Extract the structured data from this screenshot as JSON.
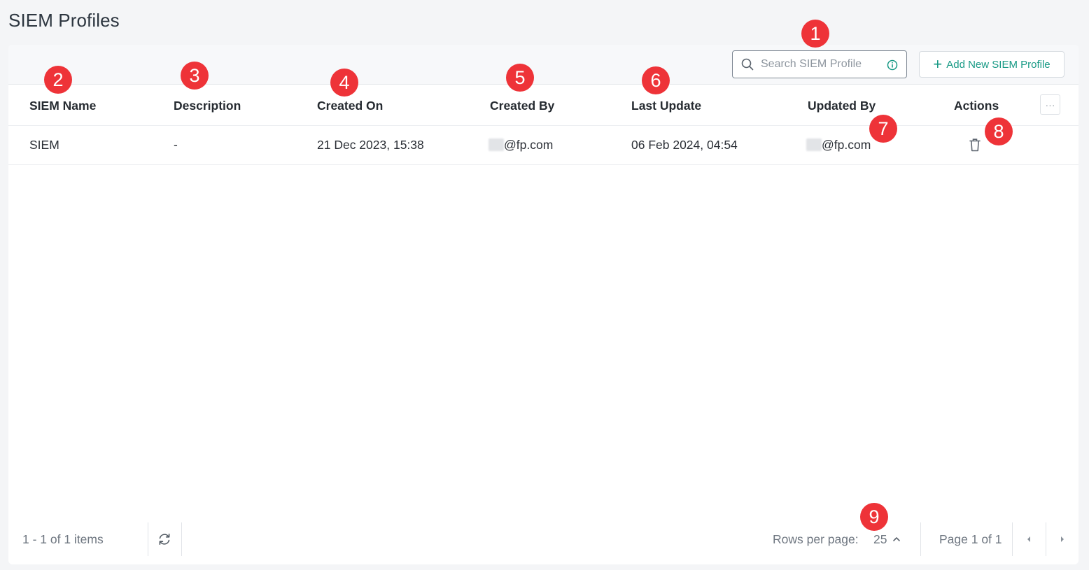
{
  "page": {
    "title": "SIEM Profiles"
  },
  "toolbar": {
    "search_placeholder": "Search SIEM Profile",
    "add_button_label": "Add New SIEM Profile"
  },
  "table": {
    "columns": [
      "SIEM Name",
      "Description",
      "Created On",
      "Created By",
      "Last Update",
      "Updated By",
      "Actions"
    ],
    "rows": [
      {
        "siem_name": "SIEM",
        "description": "-",
        "created_on": "21 Dec 2023, 15:38",
        "created_by": "@fp.com",
        "last_update": "06 Feb 2024, 04:54",
        "updated_by": "@fp.com"
      }
    ],
    "column_menu": "···"
  },
  "footer": {
    "items_count": "1 - 1 of 1 items",
    "rows_per_page_label": "Rows per page:",
    "rows_per_page_value": "25",
    "page_info": "Page 1 of 1"
  },
  "annotations": [
    "1",
    "2",
    "3",
    "4",
    "5",
    "6",
    "7",
    "8",
    "9"
  ],
  "colors": {
    "accent": "#189a85",
    "badge": "#ee3338",
    "background": "#f4f5f7"
  }
}
